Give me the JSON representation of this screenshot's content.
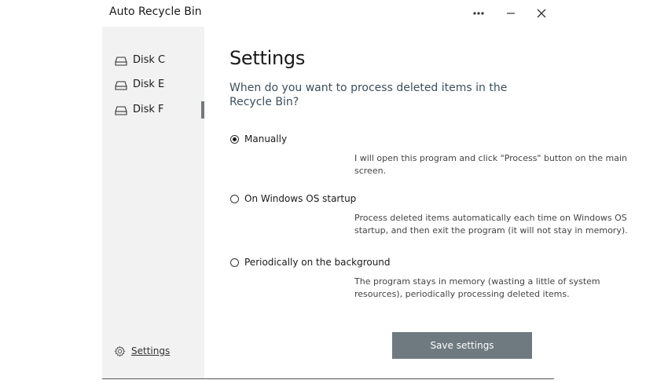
{
  "window": {
    "title": "Auto Recycle Bin",
    "controls": {
      "more": "•••",
      "minimize": "minimize",
      "close": "close"
    }
  },
  "sidebar": {
    "disks": [
      {
        "label": "Disk C",
        "icon": "drive-icon"
      },
      {
        "label": "Disk E",
        "icon": "drive-icon"
      },
      {
        "label": "Disk F",
        "icon": "drive-icon",
        "active": true
      }
    ],
    "settings_link": {
      "label": "Settings",
      "icon": "gear-icon"
    }
  },
  "main": {
    "title": "Settings",
    "question": "When do you want to process deleted items in the Recycle Bin?",
    "options": [
      {
        "label": "Manually",
        "description": "I will open this program and click \"Process\" button on the main screen.",
        "selected": true
      },
      {
        "label": "On Windows OS startup",
        "description": "Process deleted items automatically each time on Windows OS startup, and then exit the program (it will not stay in memory).",
        "selected": false
      },
      {
        "label": "Periodically on the background",
        "description": "The program stays in memory (wasting a little of system resources), periodically processing deleted items.",
        "selected": false
      }
    ],
    "save_button": "Save settings"
  },
  "colors": {
    "accent": "#6e7a80",
    "sidebar_bg": "#f2f2f2",
    "question_text": "#3d4f5c"
  }
}
